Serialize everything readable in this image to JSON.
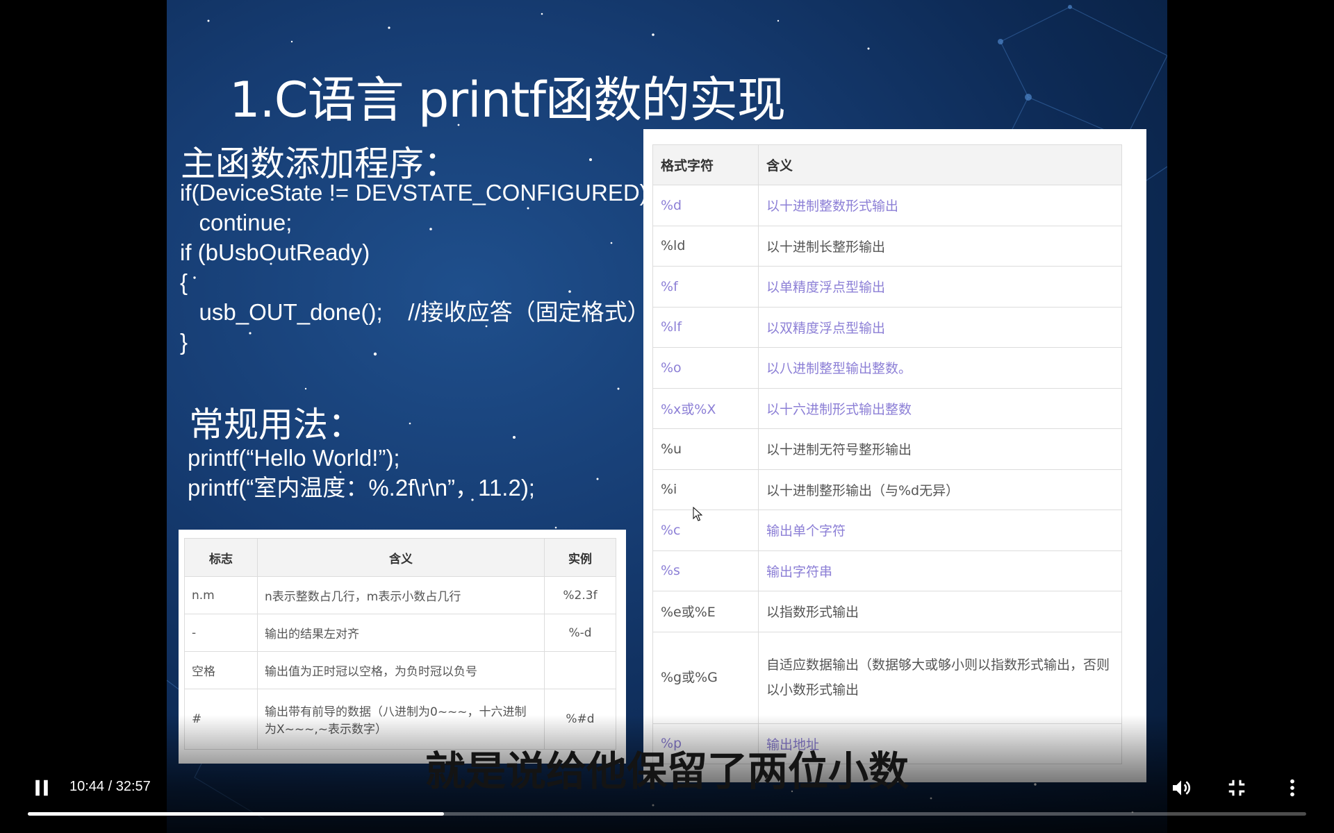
{
  "slide": {
    "title": "1.C语言 printf函数的实现",
    "main_heading": "主函数添加程序：",
    "code_lines": [
      "if(DeviceState != DEVSTATE_CONFIGURED)",
      "   continue;",
      "if (bUsbOutReady)",
      "{",
      "   usb_OUT_done();    //接收应答（固定格式）",
      "}"
    ],
    "usage_heading": "常规用法：",
    "usage_lines": [
      "printf(“Hello World!”);",
      "printf(“室内温度：%.2f\\r\\n”，11.2);"
    ],
    "flags_table": {
      "headers": [
        "标志",
        "含义",
        "实例"
      ],
      "rows": [
        [
          "n.m",
          "n表示整数占几行，m表示小数占几行",
          "%2.3f"
        ],
        [
          "-",
          "输出的结果左对齐",
          "%-d"
        ],
        [
          "空格",
          "输出值为正时冠以空格，为负时冠以负号",
          ""
        ],
        [
          "#",
          "输出带有前导的数据（八进制为0~~~，十六进制为X~~~,~表示数字）",
          "%#d"
        ]
      ]
    },
    "format_table": {
      "headers": [
        "格式字符",
        "含义"
      ],
      "rows": [
        {
          "spec": "%d",
          "meaning": "以十进制整数形式输出",
          "link": true
        },
        {
          "spec": "%ld",
          "meaning": "以十进制长整形输出",
          "link": false
        },
        {
          "spec": "%f",
          "meaning": "以单精度浮点型输出",
          "link": true
        },
        {
          "spec": "%lf",
          "meaning": "以双精度浮点型输出",
          "link": true
        },
        {
          "spec": "%o",
          "meaning": "以八进制整型输出整数。",
          "link": true
        },
        {
          "spec": "%x或%X",
          "meaning": "以十六进制形式输出整数",
          "link": true
        },
        {
          "spec": "%u",
          "meaning": "以十进制无符号整形输出",
          "link": false
        },
        {
          "spec": "%i",
          "meaning": "以十进制整形输出（与%d无异）",
          "link": false
        },
        {
          "spec": "%c",
          "meaning": "输出单个字符",
          "link": true
        },
        {
          "spec": "%s",
          "meaning": "输出字符串",
          "link": true
        },
        {
          "spec": "%e或%E",
          "meaning": "以指数形式输出",
          "link": false
        },
        {
          "spec": "%g或%G",
          "meaning": "自适应数据输出（数据够大或够小则以指数形式输出，否则以小数形式输出",
          "link": false
        },
        {
          "spec": "%p",
          "meaning": "输出地址",
          "link": true
        }
      ]
    }
  },
  "subtitle": "就是说给他保留了两位小数",
  "player": {
    "time_current": "10:44",
    "time_total": "32:57",
    "time_display": "10:44 / 32:57",
    "progress_fraction": 0.3257,
    "play_state": "playing",
    "icons": {
      "play_pause": "pause-icon",
      "volume": "volume-icon",
      "fullscreen": "fullscreen-exit-icon",
      "more": "more-vert-icon"
    }
  },
  "colors": {
    "link_text": "#8c7fd6",
    "slide_bg": "#163c72",
    "progress_fill": "#ffffff"
  }
}
